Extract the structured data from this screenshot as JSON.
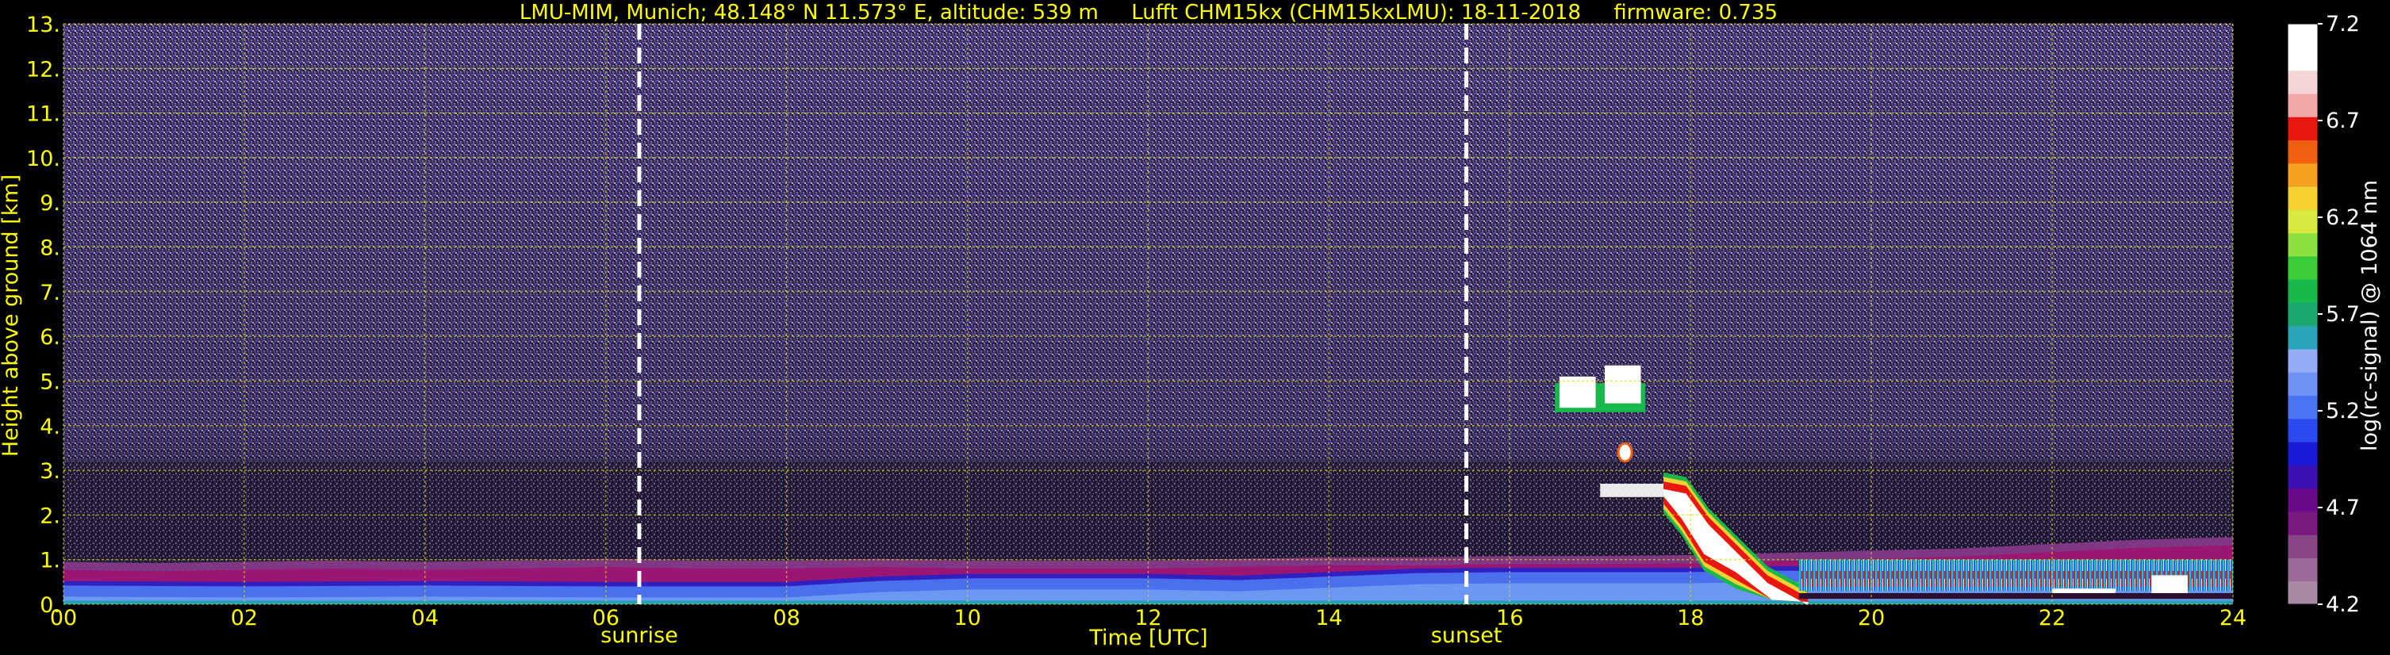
{
  "header": {
    "title": "LMU-MIM, Munich; 48.148° N 11.573° E, altitude: 539 m     Lufft CHM15kx (CHM15kxLMU): 18-11-2018     firmware: 0.735"
  },
  "chart_data": {
    "type": "heatmap",
    "title": "LMU-MIM, Munich; 48.148° N 11.573° E, altitude: 539 m     Lufft CHM15kx (CHM15kxLMU): 18-11-2018     firmware: 0.735",
    "xlabel": "Time [UTC]",
    "ylabel": "Height above ground [km]",
    "xlim": [
      0,
      24
    ],
    "ylim": [
      0,
      13
    ],
    "x_ticks": [
      "00",
      "02",
      "04",
      "06",
      "08",
      "10",
      "12",
      "14",
      "16",
      "18",
      "20",
      "22",
      "24"
    ],
    "y_ticks": [
      "0.",
      "1.",
      "2.",
      "3.",
      "4.",
      "5.",
      "6.",
      "7.",
      "8.",
      "9.",
      "10.",
      "11.",
      "12.",
      "13."
    ],
    "grid": true,
    "colorbar": {
      "label": "log(rc-signal) @ 1064 nm",
      "range": [
        4.2,
        7.2
      ],
      "ticks": [
        "4.2",
        "4.7",
        "5.2",
        "5.7",
        "6.2",
        "6.7",
        "7.2"
      ],
      "colors": [
        "#a88aa6",
        "#9a6a98",
        "#8a4488",
        "#7a1a80",
        "#6a0a8a",
        "#3a10b0",
        "#1a1ad8",
        "#2a4af0",
        "#4a74f4",
        "#6e92f6",
        "#94acf6",
        "#2aa4b8",
        "#1aa870",
        "#18b84a",
        "#3ccc3a",
        "#8ee040",
        "#d8ea40",
        "#f4d030",
        "#f4a020",
        "#f06010",
        "#e81810",
        "#f0a8a8",
        "#f4d4d4",
        "#ffffff",
        "#ffffff"
      ]
    },
    "annotations": [
      {
        "label": "sunrise",
        "x": 6.37
      },
      {
        "label": "sunset",
        "x": 15.52
      }
    ],
    "boundary_layer_top_km": [
      [
        0.0,
        0.95
      ],
      [
        1.0,
        0.92
      ],
      [
        2.0,
        0.95
      ],
      [
        3.0,
        0.98
      ],
      [
        4.0,
        0.95
      ],
      [
        5.0,
        0.98
      ],
      [
        6.0,
        1.02
      ],
      [
        7.0,
        0.98
      ],
      [
        8.0,
        0.98
      ],
      [
        9.0,
        1.02
      ],
      [
        10.0,
        0.98
      ],
      [
        11.0,
        0.98
      ],
      [
        12.0,
        0.98
      ],
      [
        13.0,
        1.02
      ],
      [
        14.0,
        1.05
      ],
      [
        15.0,
        1.05
      ],
      [
        16.0,
        1.08
      ],
      [
        17.0,
        1.08
      ],
      [
        18.0,
        1.1
      ],
      [
        19.0,
        1.15
      ],
      [
        20.0,
        1.2
      ],
      [
        21.0,
        1.25
      ],
      [
        22.0,
        1.35
      ],
      [
        23.0,
        1.45
      ],
      [
        24.0,
        1.5
      ]
    ],
    "aerosol_layer_top_km": [
      [
        0.0,
        0.62
      ],
      [
        2.0,
        0.6
      ],
      [
        4.0,
        0.62
      ],
      [
        6.0,
        0.6
      ],
      [
        8.0,
        0.6
      ],
      [
        9.0,
        0.72
      ],
      [
        10.0,
        0.78
      ],
      [
        12.0,
        0.78
      ],
      [
        13.0,
        0.74
      ],
      [
        14.0,
        0.82
      ],
      [
        15.0,
        0.9
      ],
      [
        16.0,
        0.92
      ],
      [
        17.0,
        0.92
      ],
      [
        18.0,
        0.92
      ],
      [
        19.0,
        0.95
      ],
      [
        20.0,
        0.95
      ],
      [
        22.0,
        0.95
      ],
      [
        24.0,
        0.95
      ]
    ],
    "cloud_features": [
      {
        "t_start": 16.5,
        "t_end": 17.5,
        "h_bottom": 4.2,
        "h_top": 5.4
      },
      {
        "t_start": 17.2,
        "t_end": 17.35,
        "h_bottom": 3.2,
        "h_top": 3.6
      },
      {
        "t_start": 17.0,
        "t_end": 17.7,
        "h_bottom": 2.4,
        "h_top": 2.7
      },
      {
        "t_start": 17.7,
        "t_end": 19.3,
        "h_bottom": 0.1,
        "h_top": 2.6
      },
      {
        "t_start": 20.3,
        "t_end": 24.0,
        "h_bottom": 0.3,
        "h_top": 1.1
      }
    ]
  }
}
